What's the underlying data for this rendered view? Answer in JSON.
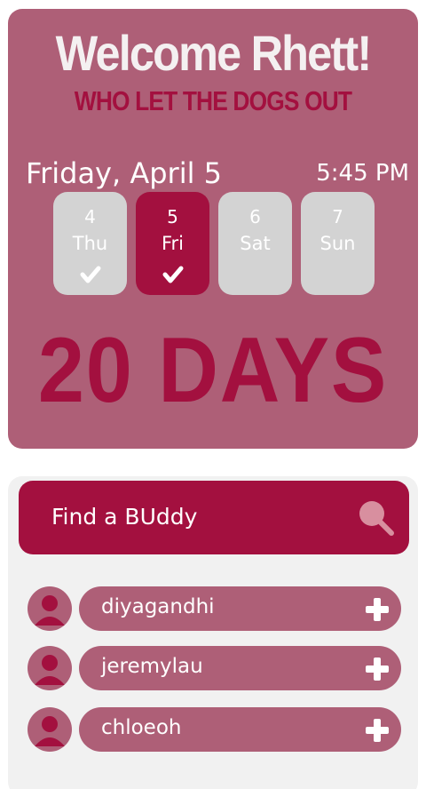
{
  "header": {
    "welcome": "Welcome Rhett!",
    "subtitle": "WHO LET THE DOGS OUT"
  },
  "schedule": {
    "date": "Friday, April 5",
    "time": "5:45 PM",
    "days": [
      {
        "num": "4",
        "dow": "Thu",
        "checked": true,
        "selected": false
      },
      {
        "num": "5",
        "dow": "Fri",
        "checked": true,
        "selected": true
      },
      {
        "num": "6",
        "dow": "Sat",
        "checked": false,
        "selected": false
      },
      {
        "num": "7",
        "dow": "Sun",
        "checked": false,
        "selected": false
      }
    ],
    "countdown": "20 DAYS"
  },
  "buddies": {
    "search_label": "Find a BUddy",
    "list": [
      {
        "name": "diyagandhi"
      },
      {
        "name": "jeremylau"
      },
      {
        "name": "chloeoh"
      }
    ]
  },
  "colors": {
    "primary": "#a3103f",
    "secondary": "#ae5f77",
    "inactive_day": "#d3d3d3",
    "panel": "#f1f1f1"
  }
}
